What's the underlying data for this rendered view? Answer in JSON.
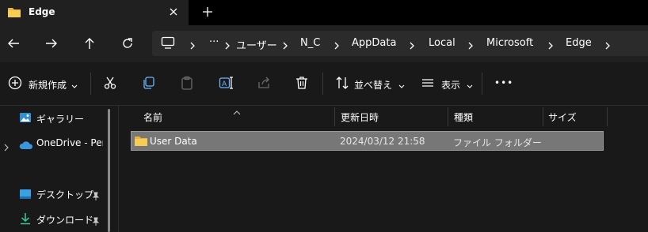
{
  "window": {
    "tab_title": "Edge",
    "new_tab_label": "+"
  },
  "address": {
    "crumbs": [
      "ユーザー",
      "N_C",
      "AppData",
      "Local",
      "Microsoft",
      "Edge"
    ],
    "overflow": "···"
  },
  "toolbar": {
    "new_label": "新規作成",
    "sort_label": "並べ替え",
    "view_label": "表示",
    "more_label": "•••"
  },
  "sidebar": {
    "items": [
      {
        "label": "ギャラリー",
        "icon": "gallery-icon"
      },
      {
        "label": "OneDrive - Personal",
        "icon": "onedrive-cloud-icon"
      },
      {
        "label": "デスクトップ",
        "icon": "desktop-icon"
      },
      {
        "label": "ダウンロード",
        "icon": "download-icon"
      }
    ]
  },
  "columns": {
    "name": "名前",
    "modified": "更新日時",
    "type": "種類",
    "size": "サイズ"
  },
  "rows": [
    {
      "name": "User Data",
      "modified": "2024/03/12 21:58",
      "type": "ファイル フォルダー",
      "size": ""
    }
  ],
  "colors": {
    "accent_folder": "#f2c443",
    "selection": "#777777",
    "onedrive": "#3a96dd"
  }
}
